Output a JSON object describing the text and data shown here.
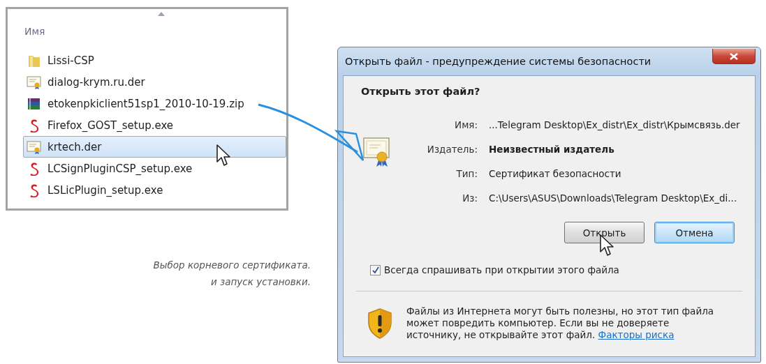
{
  "explorer": {
    "column_header": "Имя",
    "files": [
      {
        "name": "Lissi-CSP",
        "kind": "folder",
        "selected": false
      },
      {
        "name": "dialog-krym.ru.der",
        "kind": "certificate",
        "selected": false
      },
      {
        "name": "etokenpkiclient51sp1_2010-10-19.zip",
        "kind": "archive",
        "selected": false
      },
      {
        "name": "Firefox_GOST_setup.exe",
        "kind": "installer",
        "selected": false
      },
      {
        "name": "krtech.der",
        "kind": "certificate",
        "selected": true
      },
      {
        "name": "LCSignPluginCSP_setup.exe",
        "kind": "installer",
        "selected": false
      },
      {
        "name": "LSLicPlugin_setup.exe",
        "kind": "installer",
        "selected": false
      }
    ]
  },
  "caption": [
    "Выбор корневого сертификата.",
    "и запуск установки."
  ],
  "dialog": {
    "title": "Открыть файл - предупреждение системы безопасности",
    "heading": "Открыть этот файл?",
    "fields": [
      {
        "label": "Имя:",
        "value": "...Telegram Desktop\\Ex_distr\\Ex_distr\\Крымсвязь.der",
        "emphasized": false
      },
      {
        "label": "Издатель:",
        "value": "Неизвестный издатель",
        "emphasized": true
      },
      {
        "label": "Тип:",
        "value": "Сертификат безопасности",
        "emphasized": false
      },
      {
        "label": "Из:",
        "value": "C:\\Users\\ASUS\\Downloads\\Telegram Desktop\\Ex_di...",
        "emphasized": false
      }
    ],
    "buttons": [
      {
        "label": "Открыть",
        "default": false
      },
      {
        "label": "Отмена",
        "default": true
      }
    ],
    "checkbox": {
      "label": "Всегда спрашивать при открытии этого файла",
      "checked": true
    },
    "warning": {
      "text": "Файлы из Интернета могут быть полезны, но этот тип файла может повредить компьютер. Если вы не доверяете источнику, не открывайте этот файл.",
      "link": "Факторы риска"
    }
  }
}
